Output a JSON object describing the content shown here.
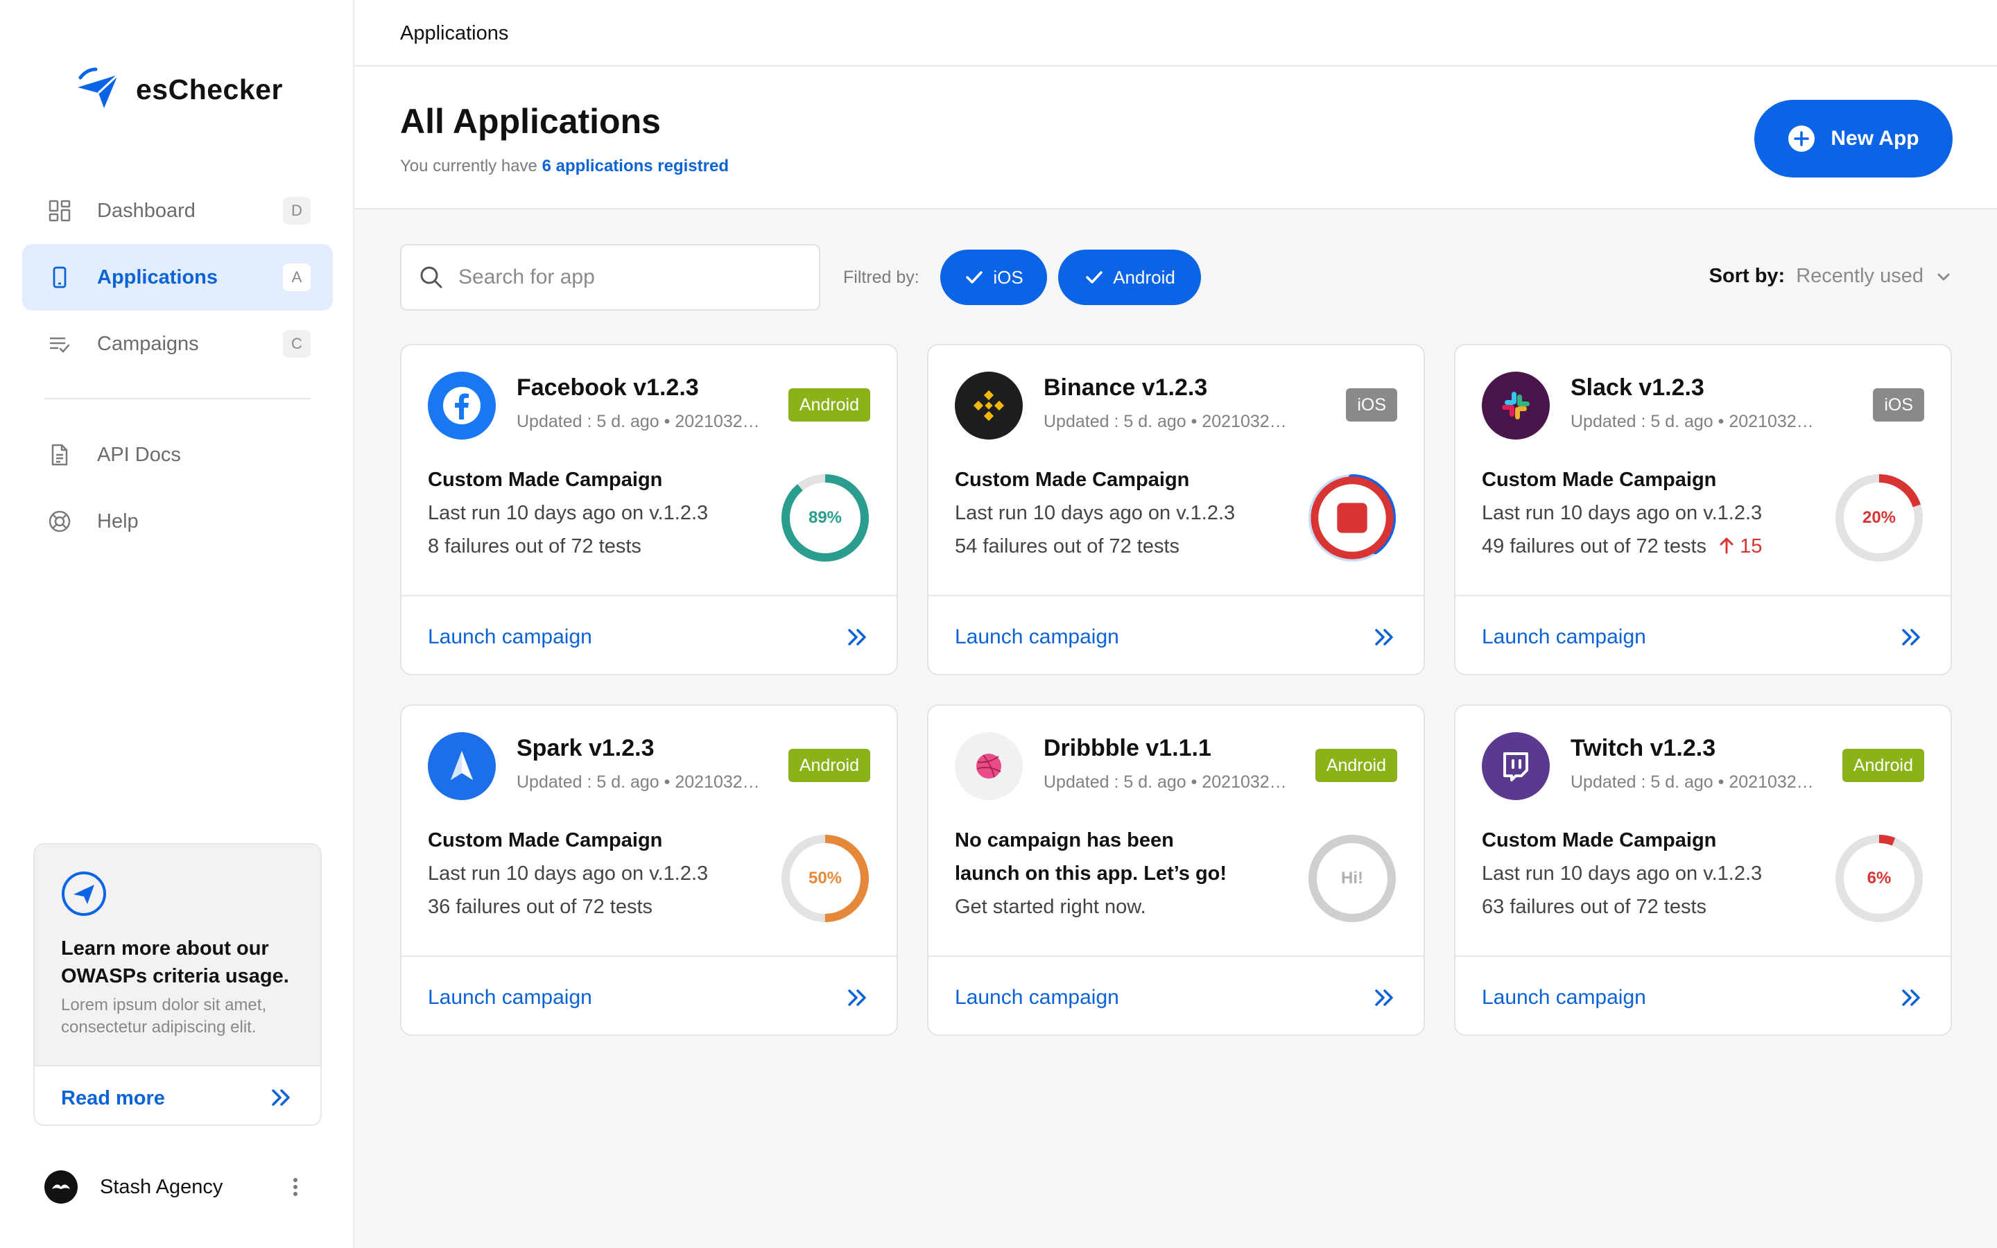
{
  "brand": {
    "name": "esChecker",
    "accent": "#0b63e6"
  },
  "sidebar": {
    "items": [
      {
        "label": "Dashboard",
        "shortcut": "D",
        "icon": "grid-icon"
      },
      {
        "label": "Applications",
        "shortcut": "A",
        "icon": "phone-icon"
      },
      {
        "label": "Campaigns",
        "shortcut": "C",
        "icon": "list-check-icon"
      },
      {
        "label": "API Docs",
        "icon": "document-icon"
      },
      {
        "label": "Help",
        "icon": "lifebuoy-icon"
      }
    ],
    "active": "Applications",
    "promo": {
      "title": "Learn more about our OWASPs criteria usage.",
      "text": "Lorem ipsum dolor sit amet, consectetur adipiscing elit.",
      "link": "Read more"
    },
    "account": {
      "name": "Stash Agency"
    }
  },
  "breadcrumb": "Applications",
  "header": {
    "title": "All Applications",
    "subtitle_prefix": "You currently have",
    "subtitle_highlight": "6 applications registred",
    "new_button": "New App"
  },
  "toolbar": {
    "search_placeholder": "Search for app",
    "filter_label": "Filtred by:",
    "filters": [
      "iOS",
      "Android"
    ],
    "sort_label": "Sort by:",
    "sort_value": "Recently used"
  },
  "cards": [
    {
      "name": "Facebook v1.2.3",
      "meta": "Updated : 5 d. ago  •  2021032…",
      "platform": "Android",
      "line1": "Custom Made Campaign",
      "line2": "Last run 10 days ago on v.1.2.3",
      "line3": "8 failures out of 72 tests",
      "trend": "",
      "ring_label": "89%",
      "progress": 0.89,
      "ring_color": "#2a9d8f",
      "launch": "Launch campaign"
    },
    {
      "name": "Binance v1.2.3",
      "meta": "Updated : 5 d. ago  •  2021032…",
      "platform": "iOS",
      "line1": "Custom Made Campaign",
      "line2": "Last run 10 days ago on v.1.2.3",
      "line3": "54 failures out of 72 tests",
      "trend": "",
      "ring_label": "",
      "progress": 0.4,
      "ring_color": "#0b63e6",
      "launch": "Launch campaign"
    },
    {
      "name": "Slack v1.2.3",
      "meta": "Updated : 5 d. ago  •  2021032…",
      "platform": "iOS",
      "line1": "Custom Made Campaign",
      "line2": "Last run 10 days ago on v.1.2.3",
      "line3": "49 failures out of 72 tests",
      "trend": "15",
      "ring_label": "20%",
      "progress": 0.2,
      "ring_color": "#d83434",
      "launch": "Launch campaign"
    },
    {
      "name": "Spark v1.2.3",
      "meta": "Updated : 5 d. ago  •  2021032…",
      "platform": "Android",
      "line1": "Custom Made Campaign",
      "line2": "Last run 10 days ago on v.1.2.3",
      "line3": "36 failures out of 72 tests",
      "trend": "",
      "ring_label": "50%",
      "progress": 0.5,
      "ring_color": "#e5883a",
      "launch": "Launch campaign"
    },
    {
      "name": "Dribbble v1.1.1",
      "meta": "Updated : 5 d. ago  •  2021032…",
      "platform": "Android",
      "line1": "No campaign has been",
      "line2": "launch on this app. Let’s go!",
      "line3": "Get started right now.",
      "trend": "",
      "ring_label": "Hi!",
      "progress": 0,
      "ring_color": "#c8c8c8",
      "launch": "Launch campaign"
    },
    {
      "name": "Twitch v1.2.3",
      "meta": "Updated : 5 d. ago  •  2021032…",
      "platform": "Android",
      "line1": "Custom Made Campaign",
      "line2": "Last run 10 days ago on v.1.2.3",
      "line3": "63 failures out of 72 tests",
      "trend": "",
      "ring_label": "6%",
      "progress": 0.06,
      "ring_color": "#d83434",
      "launch": "Launch campaign"
    }
  ]
}
